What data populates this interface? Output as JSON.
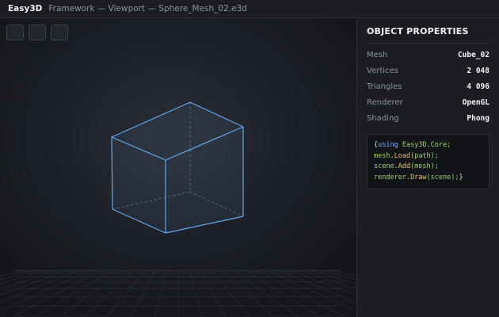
{
  "titlebar": {
    "app_name": "Easy3D",
    "path": "Framework — Viewport — Sphere_Mesh_02.e3d"
  },
  "toolbar": {
    "buttons": [
      {
        "icon": "tool-icon-1"
      },
      {
        "icon": "tool-icon-2"
      },
      {
        "icon": "tool-icon-3"
      }
    ]
  },
  "viewport": {
    "wireframe_color": "#6fb6ff",
    "grid_color": "#2c3038"
  },
  "panel": {
    "title": "OBJECT PROPERTIES",
    "properties": [
      {
        "label": "Mesh",
        "value": "Cube_02"
      },
      {
        "label": "Vertices",
        "value": "2 048"
      },
      {
        "label": "Triangles",
        "value": "4 096"
      },
      {
        "label": "Renderer",
        "value": "OpenGL"
      },
      {
        "label": "Shading",
        "value": "Phong"
      }
    ],
    "code_lines": [
      [
        {
          "t": "{",
          "c": "pl"
        },
        {
          "t": "using",
          "c": "kw"
        },
        {
          "t": " Easy3D.Core;",
          "c": "str"
        }
      ],
      [
        {
          "t": "mesh.",
          "c": "str"
        },
        {
          "t": "Load",
          "c": "fn"
        },
        {
          "t": "(path);",
          "c": "str"
        }
      ],
      [
        {
          "t": "scene.",
          "c": "str"
        },
        {
          "t": "Add",
          "c": "fn"
        },
        {
          "t": "(mesh);",
          "c": "str"
        }
      ],
      [
        {
          "t": "renderer.",
          "c": "str"
        },
        {
          "t": "Draw",
          "c": "fn"
        },
        {
          "t": "(scene);",
          "c": "str"
        },
        {
          "t": "}",
          "c": "pl"
        }
      ]
    ]
  }
}
